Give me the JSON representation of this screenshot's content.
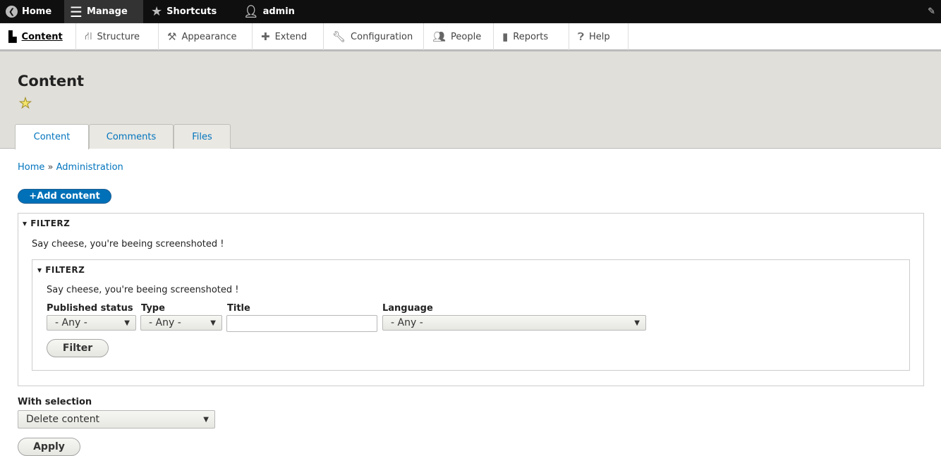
{
  "toolbar": {
    "home": "Home",
    "manage": "Manage",
    "shortcuts": "Shortcuts",
    "user": "admin"
  },
  "tray": [
    "Content",
    "Structure",
    "Appearance",
    "Extend",
    "Configuration",
    "People",
    "Reports",
    "Help"
  ],
  "page": {
    "title": "Content",
    "tabs": [
      "Content",
      "Comments",
      "Files"
    ]
  },
  "breadcrumb": {
    "home": "Home",
    "sep": "»",
    "admin": "Administration"
  },
  "add_content": "+Add content",
  "outer_filter": {
    "legend": "FILTERZ",
    "description": "Say cheese, you're beeing screenshoted !"
  },
  "inner_filter": {
    "legend": "FILTERZ",
    "description": "Say cheese, you're beeing screenshoted !",
    "status_label": "Published status",
    "status_value": "- Any -",
    "type_label": "Type",
    "type_value": "- Any -",
    "title_label": "Title",
    "title_value": "",
    "language_label": "Language",
    "language_value": "- Any -",
    "filter_button": "Filter"
  },
  "bulk": {
    "label": "With selection",
    "value": "Delete content",
    "apply": "Apply"
  }
}
